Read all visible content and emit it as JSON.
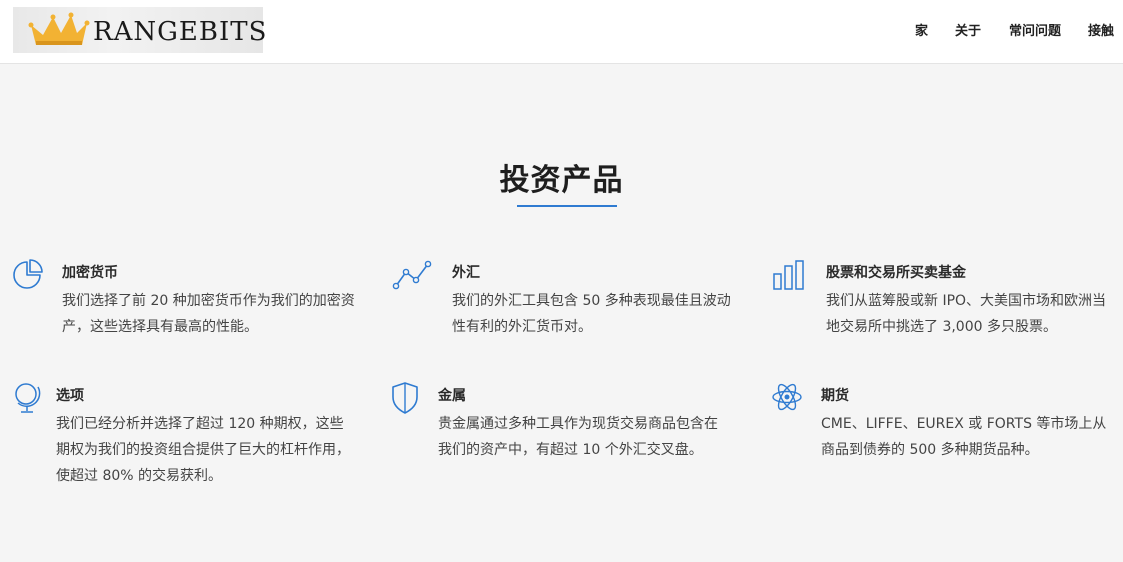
{
  "header": {
    "logo_text": "RANGEBITS",
    "nav": {
      "home": "家",
      "about": "关于",
      "faq": "常问问题",
      "contact": "接触"
    }
  },
  "section": {
    "title": "投资产品"
  },
  "products": {
    "crypto": {
      "icon": "pie-chart-icon",
      "title": "加密货币",
      "text": "我们选择了前 20 种加密货币作为我们的加密资产，这些选择具有最高的性能。"
    },
    "forex": {
      "icon": "line-graph-icon",
      "title": "外汇",
      "text": "我们的外汇工具包含 50 多种表现最佳且波动性有利的外汇货币对。"
    },
    "stocks": {
      "icon": "bar-chart-icon",
      "title": "股票和交易所买卖基金",
      "text": "我们从蓝筹股或新 IPO、大美国市场和欧洲当地交易所中挑选了 3,000 多只股票。"
    },
    "options": {
      "icon": "globe-icon",
      "title": "选项",
      "text": "我们已经分析并选择了超过 120 种期权，这些期权为我们的投资组合提供了巨大的杠杆作用，使超过 80% 的交易获利。"
    },
    "metals": {
      "icon": "shield-icon",
      "title": "金属",
      "text": "贵金属通过多种工具作为现货交易商品包含在我们的资产中，有超过 10 个外汇交叉盘。"
    },
    "futures": {
      "icon": "atom-icon",
      "title": "期货",
      "text": "CME、LIFFE、EUREX 或 FORTS 等市场上从商品到债券的 500 多种期货品种。"
    }
  },
  "colors": {
    "accent": "#2f7bd1",
    "crown_gold": "#f2b233",
    "background": "#f5f5f5"
  }
}
